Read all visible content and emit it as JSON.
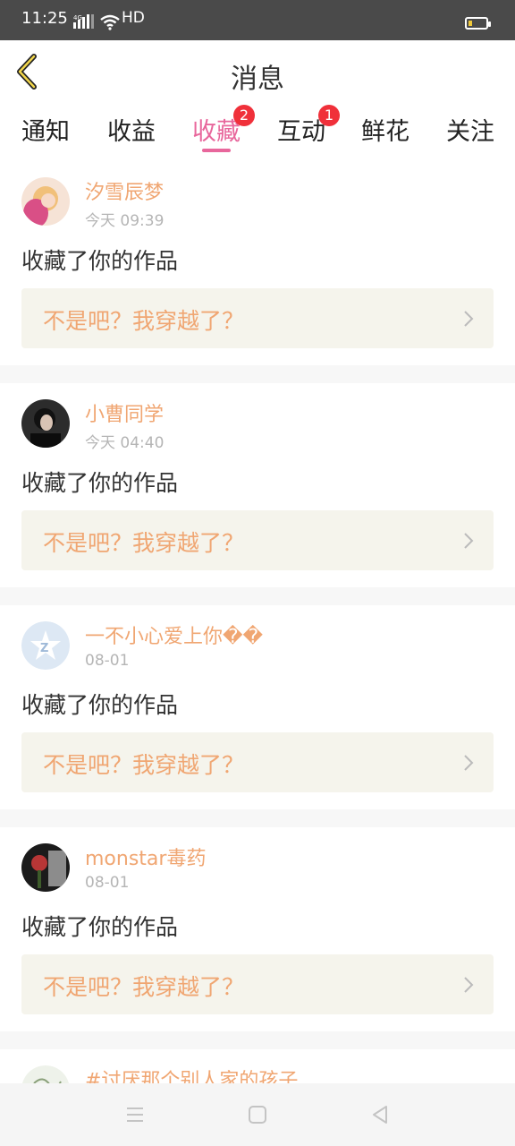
{
  "status_bar": {
    "time": "11:25",
    "network": "4G",
    "hd": "HD"
  },
  "header": {
    "title": "消息"
  },
  "tabs": [
    {
      "label": "通知",
      "badge": ""
    },
    {
      "label": "收益",
      "badge": ""
    },
    {
      "label": "收藏",
      "badge": "2",
      "active": true
    },
    {
      "label": "互动",
      "badge": "1"
    },
    {
      "label": "鲜花",
      "badge": ""
    },
    {
      "label": "关注",
      "badge": ""
    }
  ],
  "messages": [
    {
      "username": "汐雪辰梦",
      "time": "今天 09:39",
      "action": "收藏了你的作品",
      "work": "不是吧？我穿越了？"
    },
    {
      "username": "小曹同学",
      "time": "今天 04:40",
      "action": "收藏了你的作品",
      "work": "不是吧？我穿越了？"
    },
    {
      "username": "一不小心爱上你��",
      "time": "08-01",
      "action": "收藏了你的作品",
      "work": "不是吧？我穿越了？"
    },
    {
      "username": "monstar毒药",
      "time": "08-01",
      "action": "收藏了你的作品",
      "work": "不是吧？我穿越了？"
    },
    {
      "username": "#讨厌那个别人家的孩子"
    }
  ],
  "colors": {
    "accent": "#e8679c",
    "username": "#f0a672",
    "badge": "#f0303a",
    "work_bg": "#f5f4ec"
  },
  "icons": [
    "back-arrow-icon",
    "chevron-right-icon",
    "menu-icon",
    "home-icon",
    "back-triangle-icon",
    "battery-icon",
    "wifi-icon",
    "signal-icon"
  ]
}
